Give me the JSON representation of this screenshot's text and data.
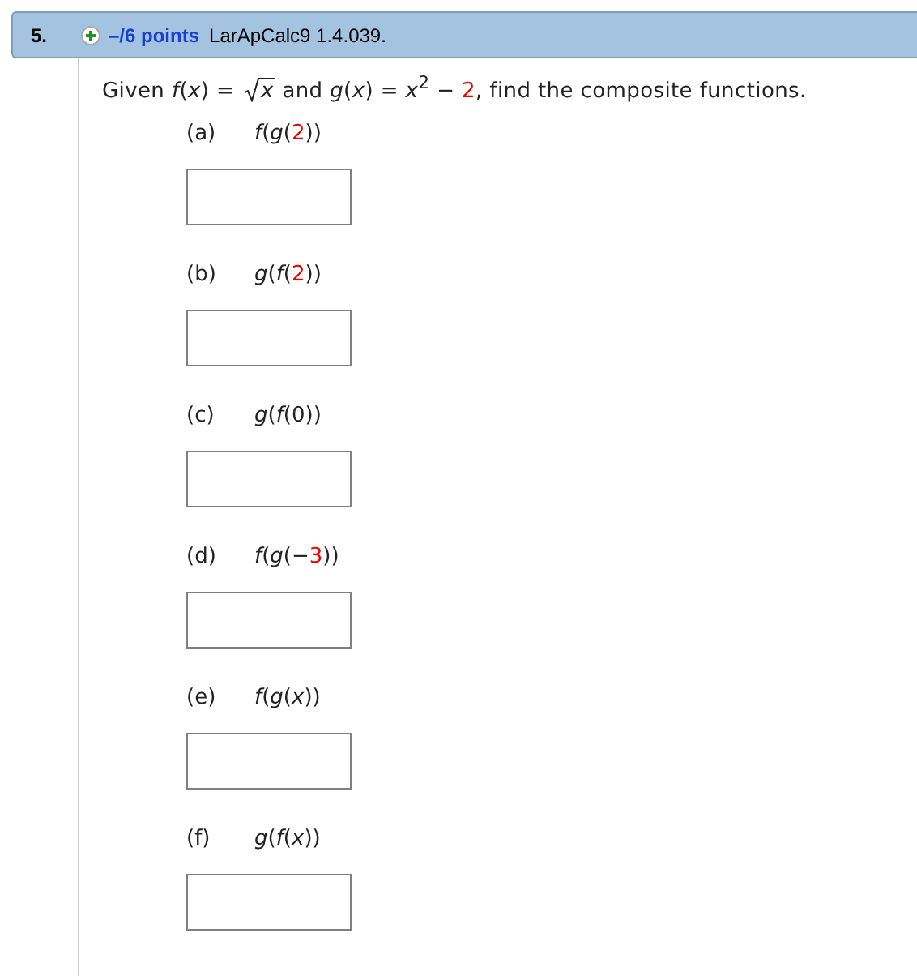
{
  "question": {
    "number": "5.",
    "points": "–/6 points",
    "source": "LarApCalc9 1.4.039."
  },
  "prompt": [
    {
      "kind": "text",
      "text": "Given *f*(*x*) = "
    },
    {
      "kind": "root",
      "text": "*x*"
    },
    {
      "kind": "text",
      "text": " and *g*(*x*) = *x*$^{2}$ − "
    },
    {
      "kind": "highlight",
      "text": "2"
    },
    {
      "kind": "text",
      "text": ", find the composite functions."
    }
  ],
  "parts": [
    {
      "label": "(a)",
      "expression": [
        {
          "kind": "text",
          "text": "*f*(*g*("
        },
        {
          "kind": "highlight",
          "text": "2"
        },
        {
          "kind": "text",
          "text": "))"
        }
      ]
    },
    {
      "label": "(b)",
      "expression": [
        {
          "kind": "text",
          "text": "*g*(*f*("
        },
        {
          "kind": "highlight",
          "text": "2"
        },
        {
          "kind": "text",
          "text": "))"
        }
      ]
    },
    {
      "label": "(c)",
      "expression": [
        {
          "kind": "text",
          "text": "*g*(*f*(0))"
        }
      ]
    },
    {
      "label": "(d)",
      "expression": [
        {
          "kind": "text",
          "text": "*f*(*g*(−"
        },
        {
          "kind": "highlight",
          "text": "3"
        },
        {
          "kind": "text",
          "text": "))"
        }
      ]
    },
    {
      "label": "(e)",
      "expression": [
        {
          "kind": "text",
          "text": "*f*(*g*(*x*))"
        }
      ]
    },
    {
      "label": "(f)",
      "expression": [
        {
          "kind": "text",
          "text": "*g*(*f*(*x*))"
        }
      ]
    }
  ]
}
